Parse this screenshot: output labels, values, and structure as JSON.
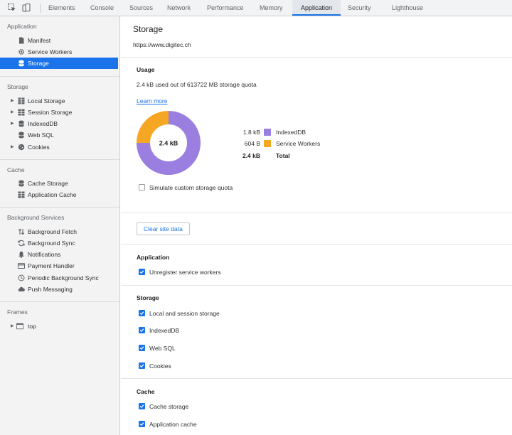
{
  "tabs": [
    "Elements",
    "Console",
    "Sources",
    "Network",
    "Performance",
    "Memory",
    "Application",
    "Security",
    "Lighthouse"
  ],
  "active_tab": "Application",
  "sidebar": {
    "application_header": "Application",
    "application_items": [
      "Manifest",
      "Service Workers",
      "Storage"
    ],
    "storage_header": "Storage",
    "storage_items": [
      "Local Storage",
      "Session Storage",
      "IndexedDB",
      "Web SQL",
      "Cookies"
    ],
    "cache_header": "Cache",
    "cache_items": [
      "Cache Storage",
      "Application Cache"
    ],
    "background_header": "Background Services",
    "background_items": [
      "Background Fetch",
      "Background Sync",
      "Notifications",
      "Payment Handler",
      "Periodic Background Sync",
      "Push Messaging"
    ],
    "frames_header": "Frames",
    "frames_items": [
      "top"
    ]
  },
  "main": {
    "title": "Storage",
    "origin": "https://www.digitec.ch",
    "usage": {
      "header": "Usage",
      "text": "2.4 kB used out of 613722 MB storage quota",
      "learn_more": "Learn more",
      "total_label": "2.4 kB",
      "simulate_label": "Simulate custom storage quota",
      "simulate_checked": false
    },
    "chart_data": {
      "type": "pie",
      "categories": [
        "IndexedDB",
        "Service Workers"
      ],
      "values": [
        1.8,
        0.604
      ],
      "value_labels": [
        "1.8 kB",
        "604 B"
      ],
      "colors": [
        "#9a7fe0",
        "#f5a623"
      ],
      "total_value_label": "2.4 kB",
      "total_name": "Total",
      "center_label": "2.4 kB"
    },
    "clear_button": "Clear site data",
    "application_section": {
      "header": "Application",
      "options": [
        {
          "label": "Unregister service workers",
          "checked": true
        }
      ]
    },
    "storage_section": {
      "header": "Storage",
      "options": [
        {
          "label": "Local and session storage",
          "checked": true
        },
        {
          "label": "IndexedDB",
          "checked": true
        },
        {
          "label": "Web SQL",
          "checked": true
        },
        {
          "label": "Cookies",
          "checked": true
        }
      ]
    },
    "cache_section": {
      "header": "Cache",
      "options": [
        {
          "label": "Cache storage",
          "checked": true
        },
        {
          "label": "Application cache",
          "checked": true
        }
      ]
    }
  },
  "colors": {
    "accent": "#1a73e8",
    "selected_bg": "#1a73e8",
    "sidebar_bg": "#f3f3f3"
  }
}
